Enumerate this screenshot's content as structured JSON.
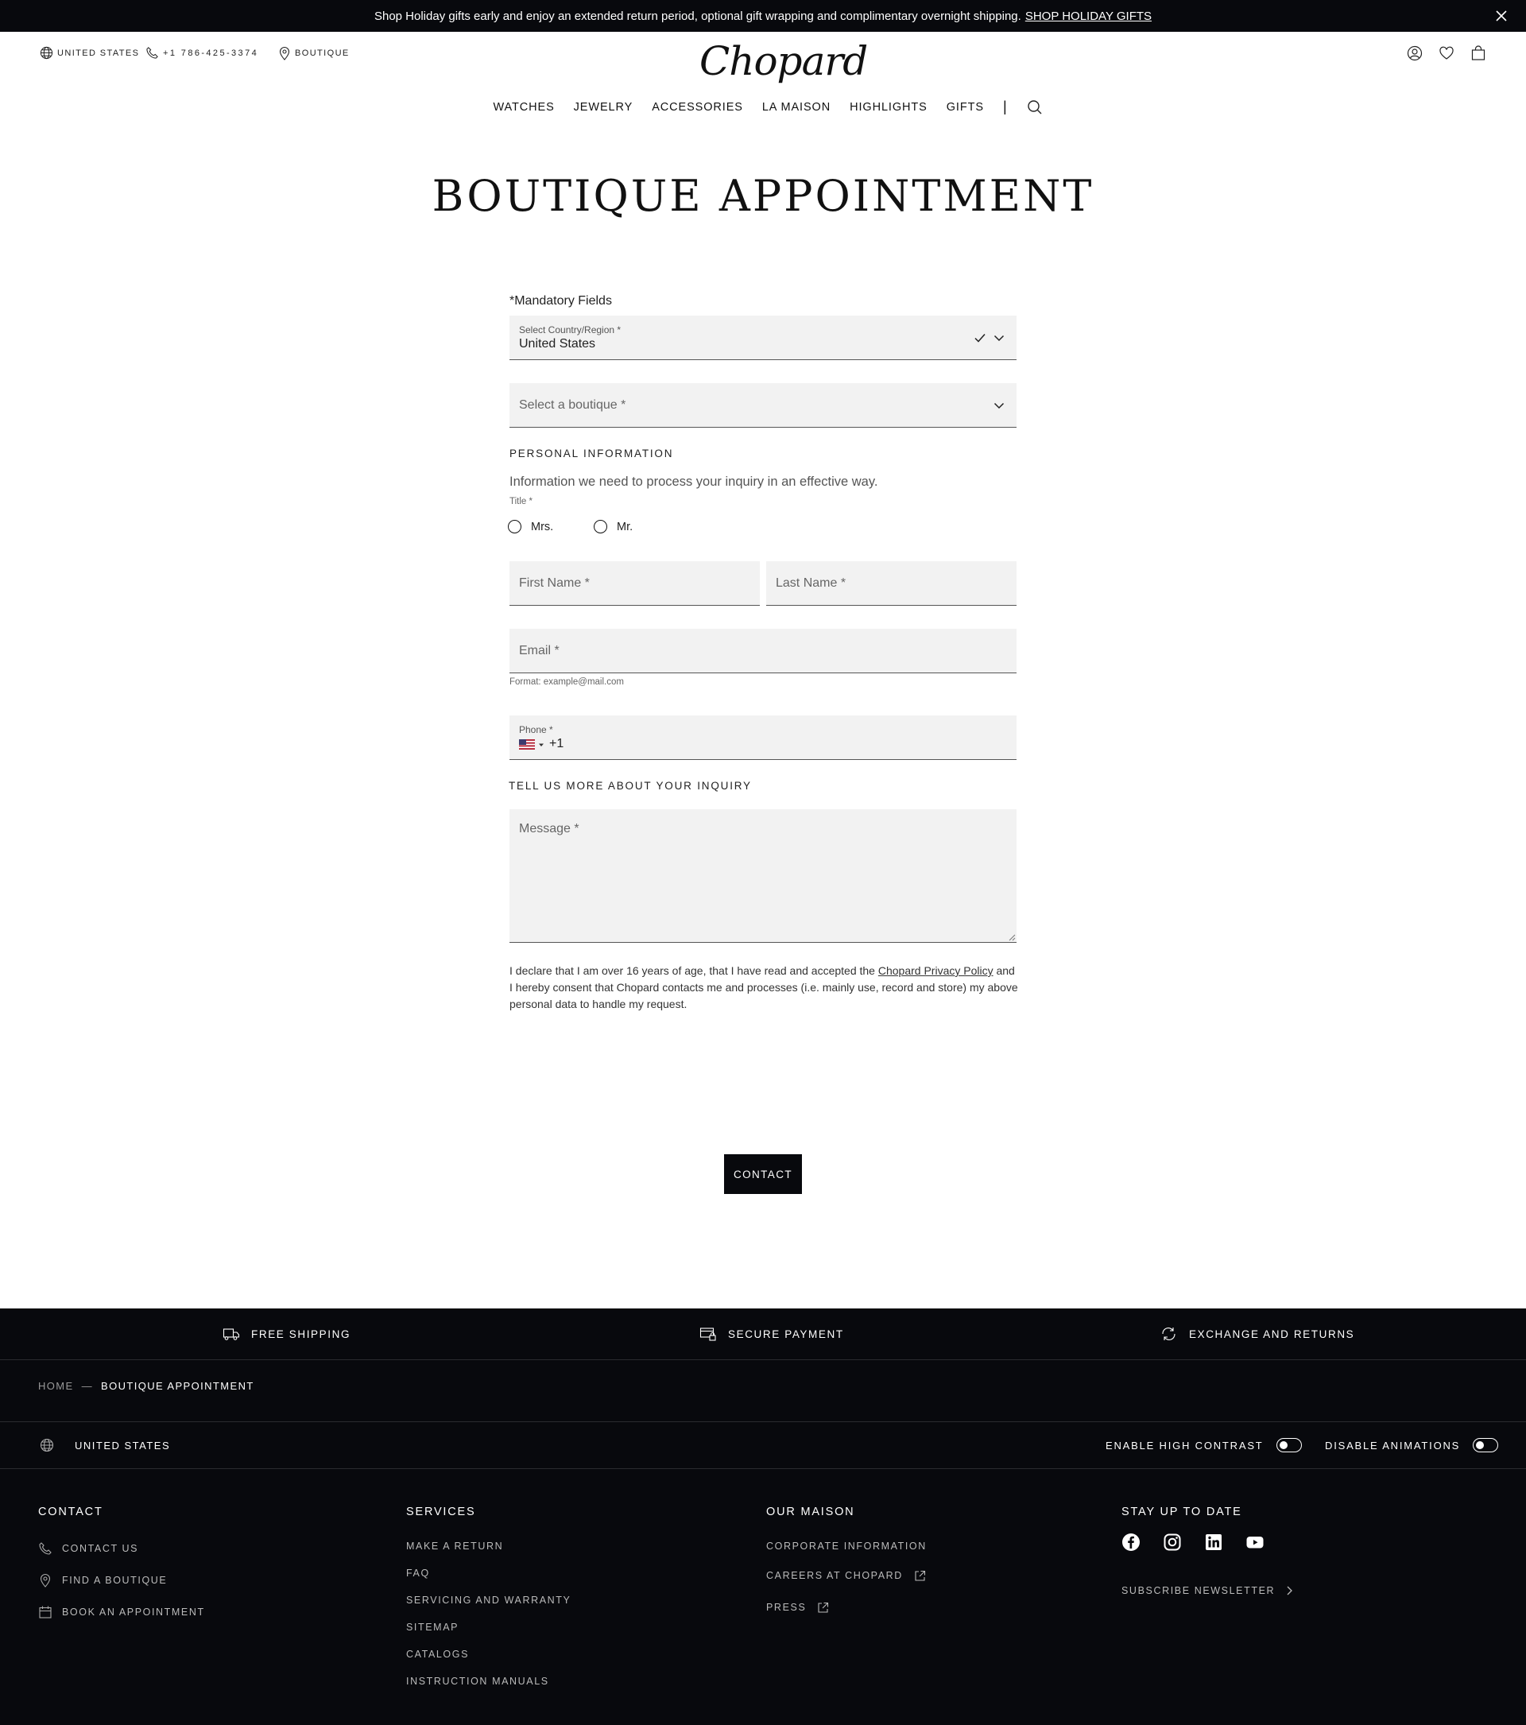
{
  "promo": {
    "text": "Shop Holiday gifts early and enjoy an extended return period, optional gift wrapping and complimentary overnight shipping.",
    "link": "SHOP HOLIDAY GIFTS"
  },
  "header": {
    "country": "UNITED STATES",
    "phone": "+1 786-425-3374",
    "boutique": "BOUTIQUE",
    "logo": "Chopard",
    "nav": [
      "WATCHES",
      "JEWELRY",
      "ACCESSORIES",
      "LA MAISON",
      "HIGHLIGHTS",
      "GIFTS"
    ],
    "nav_separator": "|"
  },
  "page": {
    "title": "BOUTIQUE APPOINTMENT",
    "mandatory": "*Mandatory Fields",
    "country_label": "Select Country/Region *",
    "country_value": "United States",
    "boutique_placeholder": "Select a boutique *",
    "personal_heading": "PERSONAL INFORMATION",
    "personal_sub": "Information we need to process your inquiry in an effective way.",
    "title_label": "Title *",
    "title_options": [
      "Mrs.",
      "Mr."
    ],
    "first_name_placeholder": "First Name *",
    "last_name_placeholder": "Last Name *",
    "email_placeholder": "Email *",
    "email_hint": "Format: example@mail.com",
    "phone_label": "Phone *",
    "phone_code": "+1",
    "inquiry_heading": "TELL US MORE ABOUT YOUR INQUIRY",
    "message_placeholder": "Message *",
    "legal_pre": "I declare that I am over 16 years of age, that I have read and accepted the",
    "legal_link": "Chopard Privacy Policy",
    "legal_post": "and I hereby consent that Chopard contacts me and processes (i.e. mainly use, record and store) my above personal data to handle my request.",
    "contact_button": "CONTACT"
  },
  "footer": {
    "reassurance": [
      "FREE SHIPPING",
      "SECURE PAYMENT",
      "EXCHANGE AND RETURNS"
    ],
    "breadcrumb": {
      "home": "HOME",
      "separator": "—",
      "current": "BOUTIQUE APPOINTMENT"
    },
    "country": "UNITED STATES",
    "high_contrast": "ENABLE HIGH CONTRAST",
    "animations": "DISABLE ANIMATIONS",
    "contact": {
      "heading": "CONTACT",
      "links": [
        "CONTACT US",
        "FIND A BOUTIQUE",
        "BOOK AN APPOINTMENT"
      ]
    },
    "services": {
      "heading": "SERVICES",
      "links": [
        "MAKE A RETURN",
        "FAQ",
        "SERVICING AND WARRANTY",
        "SITEMAP",
        "CATALOGS",
        "INSTRUCTION MANUALS"
      ]
    },
    "maison": {
      "heading": "OUR MAISON",
      "links": [
        "CORPORATE INFORMATION",
        "CAREERS AT CHOPARD",
        "PRESS"
      ]
    },
    "stay": {
      "heading": "STAY UP TO DATE",
      "subscribe": "SUBSCRIBE NEWSLETTER"
    }
  },
  "icons": {
    "globe": "globe-icon",
    "phone": "phone-icon",
    "pin": "map-pin-icon",
    "account": "account-icon",
    "wishlist": "heart-icon",
    "bag": "bag-icon",
    "search": "search-icon",
    "close": "close-icon",
    "facebook": "facebook-icon",
    "instagram": "instagram-icon",
    "linkedin": "linkedin-icon",
    "youtube": "youtube-icon"
  },
  "colors": {
    "dark": "#08090d",
    "field_bg": "#f2f2f2",
    "white": "#ffffff"
  }
}
